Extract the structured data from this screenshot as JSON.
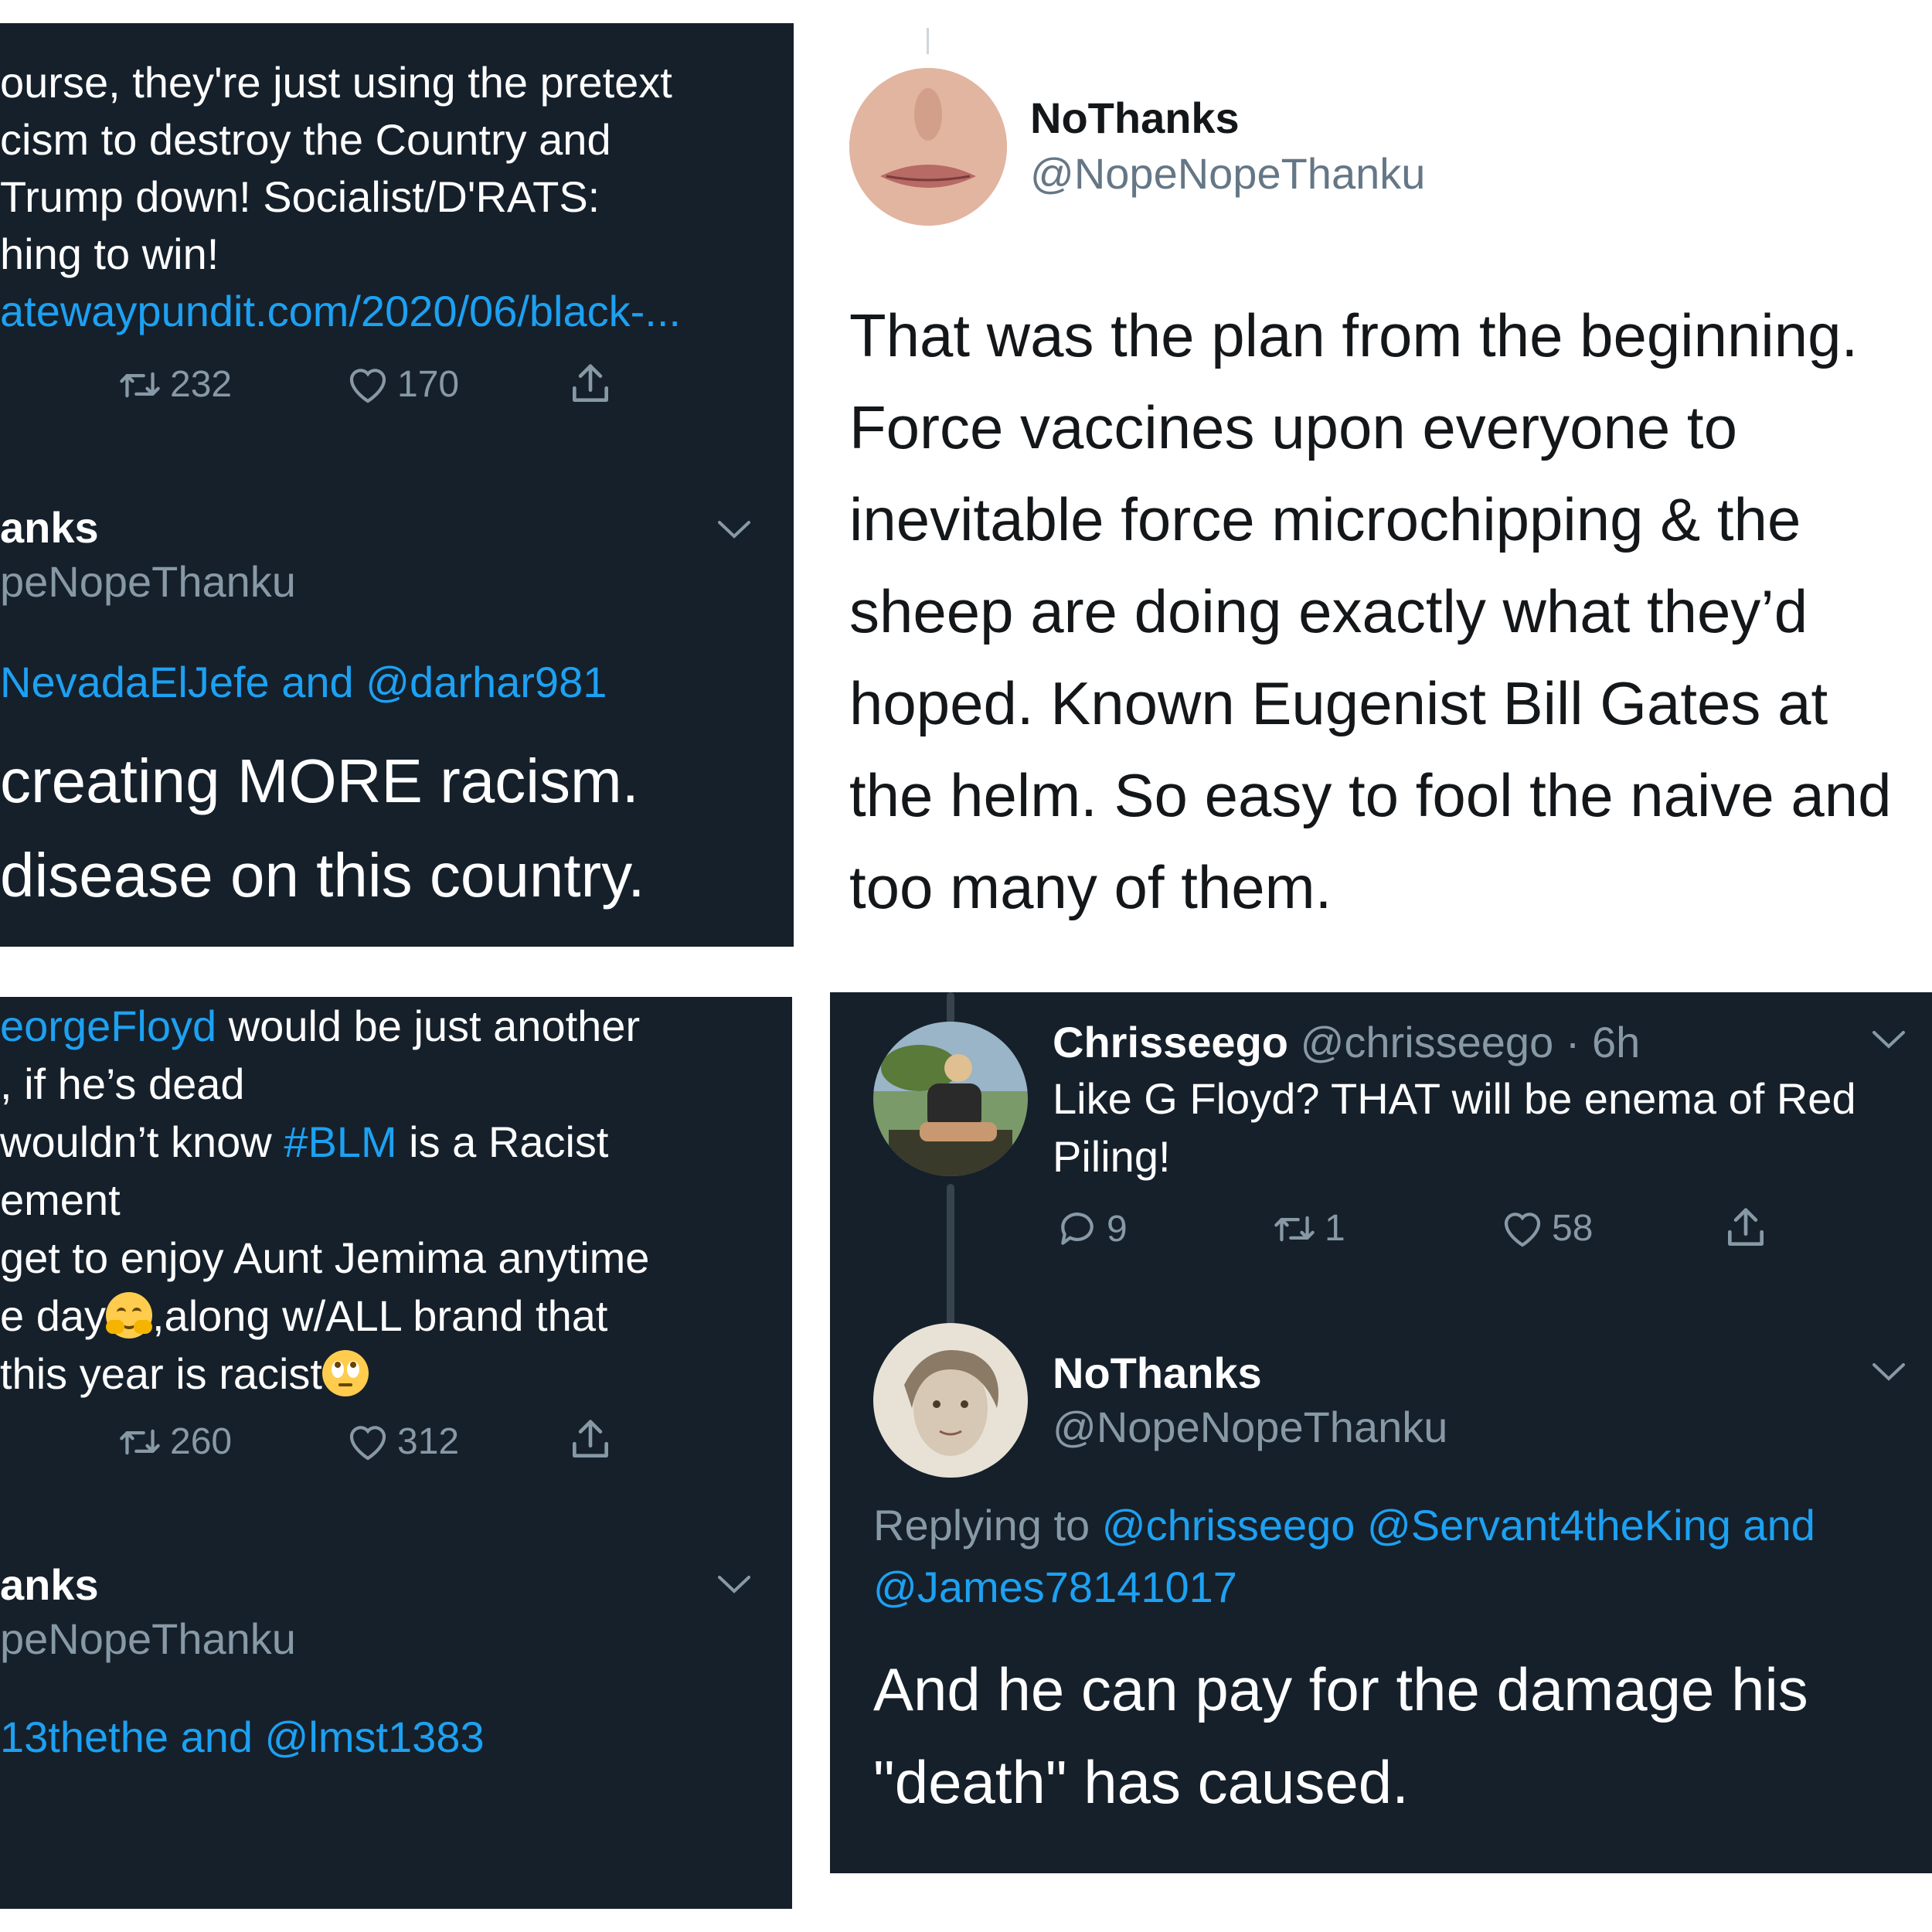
{
  "panel_tl": {
    "tweet_lines": [
      "ourse, they're just using the pretext",
      "cism to destroy the Country and",
      "Trump down! Socialist/D'RATS:",
      "hing to win!"
    ],
    "link": "atewaypundit.com/2020/06/black-...",
    "retweets": "232",
    "likes": "170",
    "author_name": "anks",
    "author_handle": "peNopeThanku",
    "reply_mentions": "NevadaElJefe and @darhar981",
    "reply_lines": [
      "creating MORE racism.",
      "disease on this country."
    ]
  },
  "panel_tr": {
    "author_name": "NoThanks",
    "author_handle": "@NopeNopeThanku",
    "body_lines": [
      "That was the plan from the beginning.",
      "Force vaccines upon everyone to",
      "inevitable force microchipping & the",
      "sheep are doing exactly what they’d",
      "hoped. Known Eugenist Bill Gates at",
      "the helm. So easy to fool the naive and",
      "too many of them."
    ]
  },
  "panel_bl": {
    "line1_tag": "eorgeFloyd",
    "line1_rest": " would be just another",
    "line2": ", if he’s dead",
    "line3_pre": "wouldn’t know ",
    "line3_tag": "#BLM",
    "line3_post": " is a Racist",
    "line4": "ement",
    "line5": "get to enjoy Aunt Jemima anytime",
    "line6_pre": "e day",
    "line6_post": ",along w/ALL brand that",
    "line7": "this year is racist",
    "retweets": "260",
    "likes": "312",
    "author_name": "anks",
    "author_handle": "peNopeThanku",
    "reply_mentions": "13thethe and @lmst1383"
  },
  "panel_br": {
    "parent_name": "Chrisseego",
    "parent_meta": "@chrisseego · 6h",
    "parent_lines": [
      "Like G Floyd? THAT will be enema of Red",
      "Piling!"
    ],
    "replies": "9",
    "retweets": "1",
    "likes": "58",
    "author_name": "NoThanks",
    "author_handle": "@NopeNopeThanku",
    "replying_label": "Replying to ",
    "replying_line1": "@chrisseego @Servant4theKing and",
    "replying_line2": "@James78141017",
    "body_lines": [
      "And he can pay for the damage his",
      "\"death\" has caused."
    ]
  },
  "colors": {
    "dark_bg": "#15202b",
    "muted": "#8899a6",
    "link": "#1da1f2",
    "divider": "#38444d"
  },
  "icons": [
    "reply-icon",
    "retweet-icon",
    "like-icon",
    "share-icon",
    "chevron-down-icon"
  ]
}
